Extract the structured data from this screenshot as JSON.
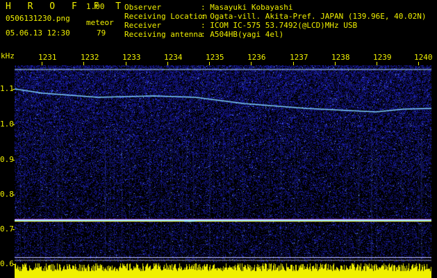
{
  "header": {
    "brand": "H R O F F T",
    "version": "1.00",
    "filename": "0506131230.png",
    "datetime": "05.06.13 12:30",
    "meteor_label": "meteor",
    "meteor_count": "79"
  },
  "station": {
    "rows": [
      {
        "key": "Observer",
        "value": ": Masayuki Kobayashi"
      },
      {
        "key": "Receiving Location",
        "value": ": Ogata-vill. Akita-Pref. JAPAN (139.96E, 40.02N)"
      },
      {
        "key": "Receiver",
        "value": ": ICOM IC-575 53.7492(@LCD)MHz USB"
      },
      {
        "key": "Receiving antenna",
        "value": ": A504HB(yagi 4el)"
      }
    ]
  },
  "axes": {
    "y_unit": "kHz",
    "y_labels": [
      "1.1",
      "1.0",
      "0.9",
      "0.8",
      "0.7",
      "0.6"
    ],
    "x_labels": [
      "1231",
      "1232",
      "1233",
      "1234",
      "1235",
      "1236",
      "1237",
      "1238",
      "1239",
      "1240"
    ]
  },
  "colors": {
    "label": "#f0f000",
    "background": "#000000",
    "noise": "#1c1ca8",
    "trace": "#7fd0ff",
    "carrier": "#b8e8ff",
    "amplitude": "#f0f000"
  }
}
